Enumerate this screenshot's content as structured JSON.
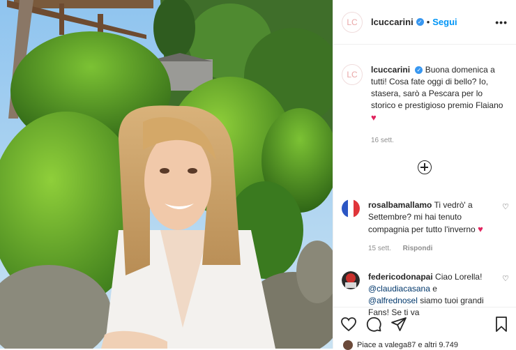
{
  "post": {
    "username": "lcuccarini",
    "avatar_text": "LC",
    "separator": "•",
    "follow_label": "Segui",
    "more_label": "•••",
    "caption": "Buona domenica a tutti! Cosa fate oggi di bello? Io, stasera, sarò a Pescara per lo storico e prestigioso premio Flaiano",
    "caption_emoji": "♥",
    "timestamp": "16 sett."
  },
  "comments": [
    {
      "username": "rosalbamallamo",
      "text": "Ti vedrò' a Settembre? mi hai tenuto compagnia per tutto l'inverno",
      "emoji": "♥",
      "time": "15 sett.",
      "reply_label": "Rispondi"
    },
    {
      "username": "federicodonapai",
      "text_start": "Ciao Lorella!",
      "mention1": "@claudiacasana",
      "conj": "e",
      "mention2": "@alfrednosel",
      "text_end": "siamo tuoi grandi Fans! Se ti va"
    }
  ],
  "likes": {
    "text": "Piace a valega87 e altri 9.749"
  },
  "colors": {
    "accent": "#0095f6",
    "verified": "#3897f0",
    "meta": "#8e8e8e"
  }
}
